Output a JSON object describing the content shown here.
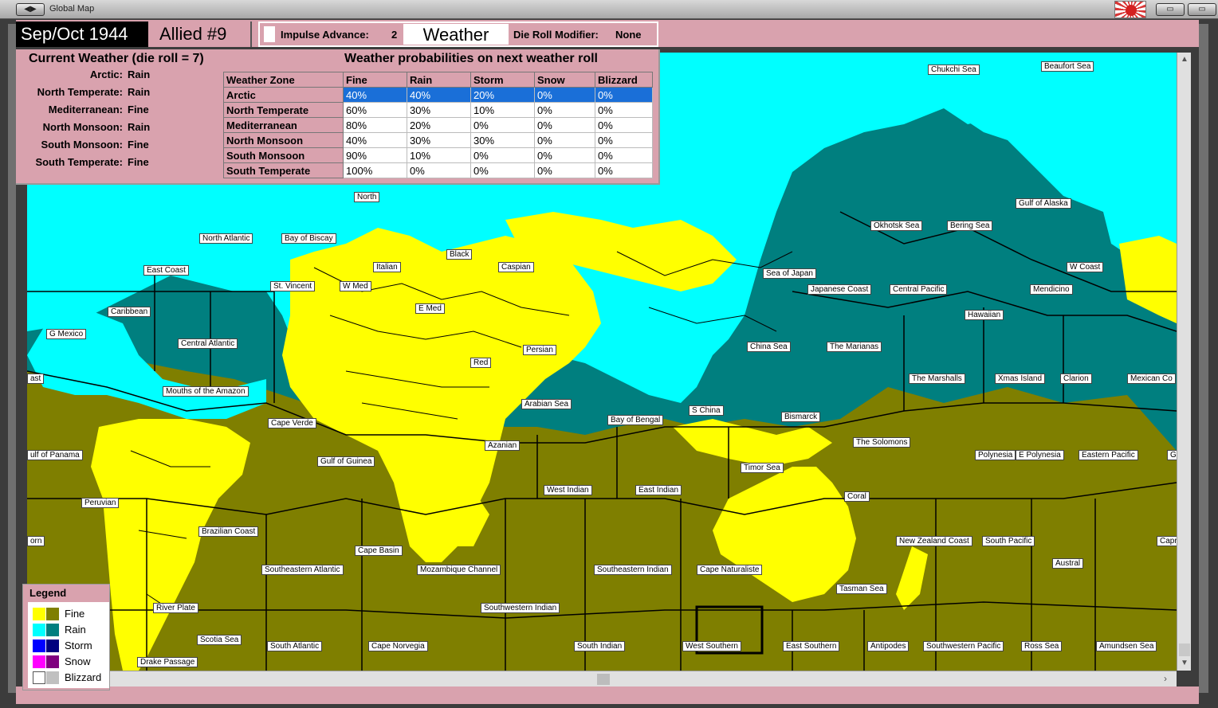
{
  "window": {
    "title": "Global Map"
  },
  "header": {
    "date": "Sep/Oct 1944",
    "turn": "Allied #9",
    "impulse_label": "Impulse Advance:",
    "impulse_value": "2",
    "weather_title": "Weather",
    "die_mod_label": "Die Roll Modifier:",
    "die_mod_value": "None"
  },
  "current_weather": {
    "title": "Current Weather (die roll = 7)",
    "zones": [
      {
        "zone": "Arctic:",
        "value": "Rain"
      },
      {
        "zone": "North Temperate:",
        "value": "Rain"
      },
      {
        "zone": "Mediterranean:",
        "value": "Fine"
      },
      {
        "zone": "North Monsoon:",
        "value": "Rain"
      },
      {
        "zone": "South Monsoon:",
        "value": "Fine"
      },
      {
        "zone": "South Temperate:",
        "value": "Fine"
      }
    ]
  },
  "probabilities": {
    "title": "Weather probabilities on next weather roll",
    "headers": [
      "Weather Zone",
      "Fine",
      "Rain",
      "Storm",
      "Snow",
      "Blizzard"
    ],
    "rows": [
      [
        "Arctic",
        "40%",
        "40%",
        "20%",
        "0%",
        "0%"
      ],
      [
        "North Temperate",
        "60%",
        "30%",
        "10%",
        "0%",
        "0%"
      ],
      [
        "Mediterranean",
        "80%",
        "20%",
        "0%",
        "0%",
        "0%"
      ],
      [
        "North Monsoon",
        "40%",
        "30%",
        "30%",
        "0%",
        "0%"
      ],
      [
        "South Monsoon",
        "90%",
        "10%",
        "0%",
        "0%",
        "0%"
      ],
      [
        "South Temperate",
        "100%",
        "0%",
        "0%",
        "0%",
        "0%"
      ]
    ],
    "selected_row": "Arctic"
  },
  "legend": {
    "title": "Legend",
    "items": [
      {
        "label": "Fine",
        "c1": "#ffff00",
        "c2": "#7f7f00"
      },
      {
        "label": "Rain",
        "c1": "#00ffff",
        "c2": "#007f7f"
      },
      {
        "label": "Storm",
        "c1": "#0000ff",
        "c2": "#00007f"
      },
      {
        "label": "Snow",
        "c1": "#ff00ff",
        "c2": "#7f007f"
      },
      {
        "label": "Blizzard",
        "c1": "#ffffff",
        "c2": "#c0c0c0"
      }
    ]
  },
  "colors": {
    "fine_land": "#ffff00",
    "fine_sea": "#7f7f00",
    "rain_land": "#00ffff",
    "rain_sea": "#007f7f",
    "panel_pink": "#d9a2ae",
    "selection": "#1a6fd8"
  },
  "sea_areas": [
    "Chukchi Sea",
    "Beaufort Sea",
    "North",
    "North Atlantic",
    "Bay of Biscay",
    "Gulf of Alaska",
    "Okhotsk Sea",
    "Bering Sea",
    "Black",
    "Italian",
    "Caspian",
    "East Coast",
    "W Coast",
    "Sea of Japan",
    "St. Vincent",
    "W Med",
    "Japanese Coast",
    "Central Pacific",
    "Mendicino",
    "Caribbean",
    "E Med",
    "Hawaiian",
    "G Mexico",
    "Central Atlantic",
    "Persian",
    "China Sea",
    "The Marianas",
    "Red",
    "ast",
    "The Marshalls",
    "Xmas Island",
    "Clarion",
    "Mexican Co",
    "Mouths of the Amazon",
    "Arabian Sea",
    "S China",
    "Bismarck",
    "Cape Verde",
    "Bay of Bengal",
    "Azanian",
    "The Solomons",
    "ulf of Panama",
    "Polynesia",
    "E Polynesia",
    "Eastern Pacific",
    "G",
    "Gulf of Guinea",
    "Timor Sea",
    "West Indian",
    "East Indian",
    "Coral",
    "Peruvian",
    "Brazilian Coast",
    "orn",
    "New Zealand Coast",
    "South Pacific",
    "Caprico",
    "Cape Basin",
    "Austral",
    "Southeastern Atlantic",
    "Mozambique Channel",
    "Southeastern Indian",
    "Cape Naturaliste",
    "Tasman Sea",
    "River Plate",
    "Southwestern Indian",
    "Scotia Sea",
    "South Atlantic",
    "Cape Norvegia",
    "South Indian",
    "West Southern",
    "East Southern",
    "Antipodes",
    "Southwestern Pacific",
    "Ross Sea",
    "Amundsen Sea",
    "Drake Passage"
  ]
}
